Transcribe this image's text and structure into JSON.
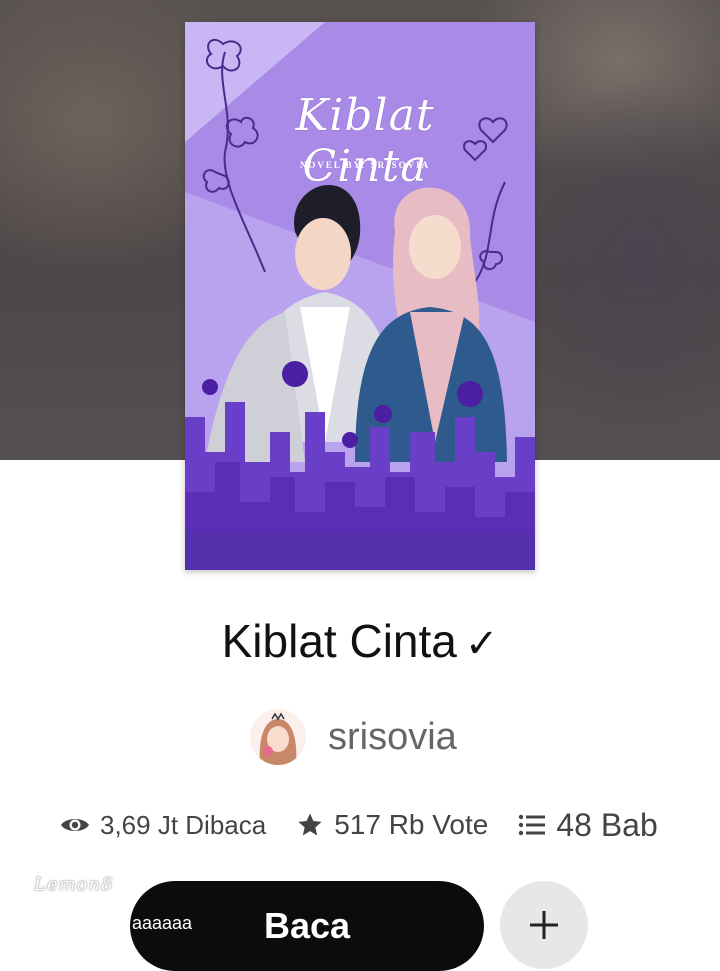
{
  "cover": {
    "title": "Kiblat Cinta",
    "subtitle": "NOVEL BY: SRISOVIA",
    "bg_color": "#b49be8",
    "accent_color": "#6a3fb5"
  },
  "book": {
    "title": "Kiblat Cinta",
    "checkmark": "✓"
  },
  "author": {
    "name": "srisovia",
    "avatar_icon": "avatar-girl-icon"
  },
  "stats": {
    "views": "3,69 Jt Dibaca",
    "views_icon": "eye-icon",
    "votes": "517 Rb Vote",
    "votes_icon": "star-icon",
    "chapters": "48 Bab",
    "chapters_icon": "list-icon"
  },
  "actions": {
    "read_label": "Baca",
    "read_overlay": "aaaaaa",
    "add_icon": "plus-icon"
  },
  "watermark": "Lemon8"
}
